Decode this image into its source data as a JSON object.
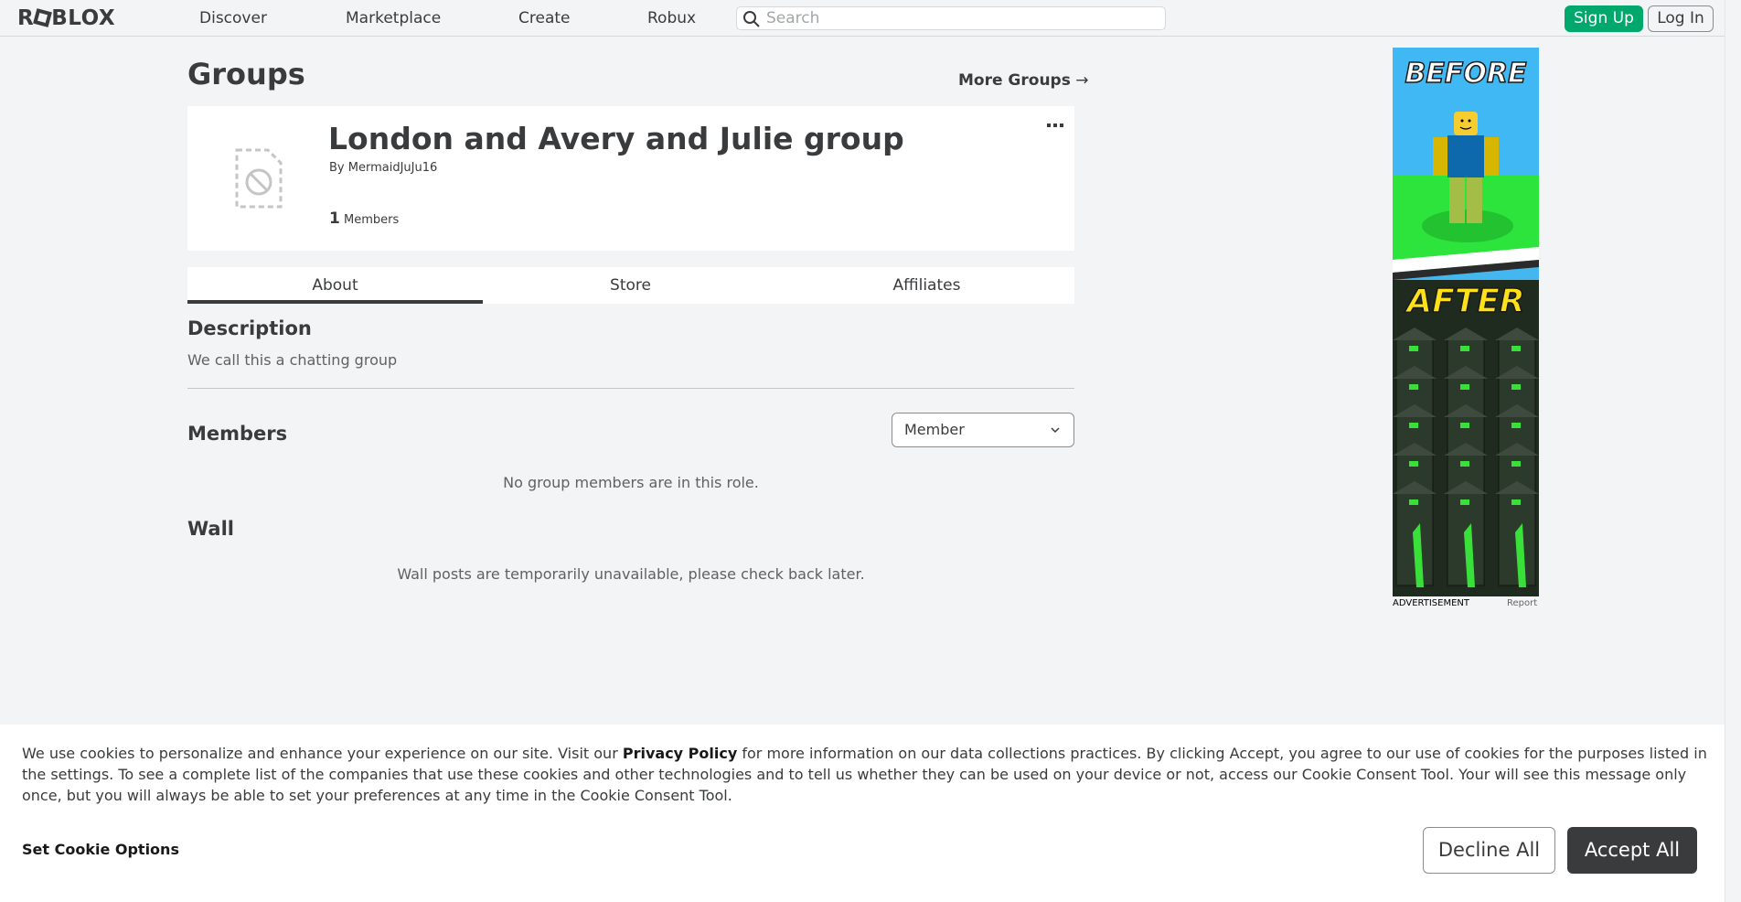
{
  "nav": {
    "logo": "ROBLOX",
    "links": [
      "Discover",
      "Marketplace",
      "Create",
      "Robux"
    ],
    "search_placeholder": "Search",
    "signup_label": "Sign Up",
    "login_label": "Log In"
  },
  "page": {
    "title": "Groups",
    "more_groups": "More Groups"
  },
  "group": {
    "name": "London and Avery and Julie group",
    "by_label": "By",
    "owner": "MermaidJuJu16",
    "member_count": "1",
    "member_label": "Members",
    "menu_icon": "more-dots-icon"
  },
  "tabs": [
    "About",
    "Store",
    "Affiliates"
  ],
  "about": {
    "description_heading": "Description",
    "description_text": "We call this a chatting group",
    "members_heading": "Members",
    "role_selected": "Member",
    "members_empty": "No group members are in this role.",
    "wall_heading": "Wall",
    "wall_empty": "Wall posts are temporarily unavailable, please check back later."
  },
  "ad": {
    "headline_top": "BEFORE",
    "headline_bottom": "AFTER",
    "label": "ADVERTISEMENT",
    "report": "Report"
  },
  "cookie": {
    "text_before": "We use cookies to personalize and enhance your experience on our site. Visit our ",
    "privacy_link": "Privacy Policy",
    "text_after": " for more information on our data collections practices. By clicking Accept, you agree to our use of cookies for the purposes listed in the settings. To see a complete list of the companies that use these cookies and other technologies and to tell us whether they can be used on your device or not, access our Cookie Consent Tool. Your will see this message only once, but you will always be able to set your preferences at any time in the Cookie Consent Tool.",
    "options_label": "Set Cookie Options",
    "decline_label": "Decline All",
    "accept_label": "Accept All"
  },
  "colors": {
    "signup_green": "#00a86b",
    "accept_dark": "#393b3d",
    "page_bg": "#f2f4f5"
  }
}
